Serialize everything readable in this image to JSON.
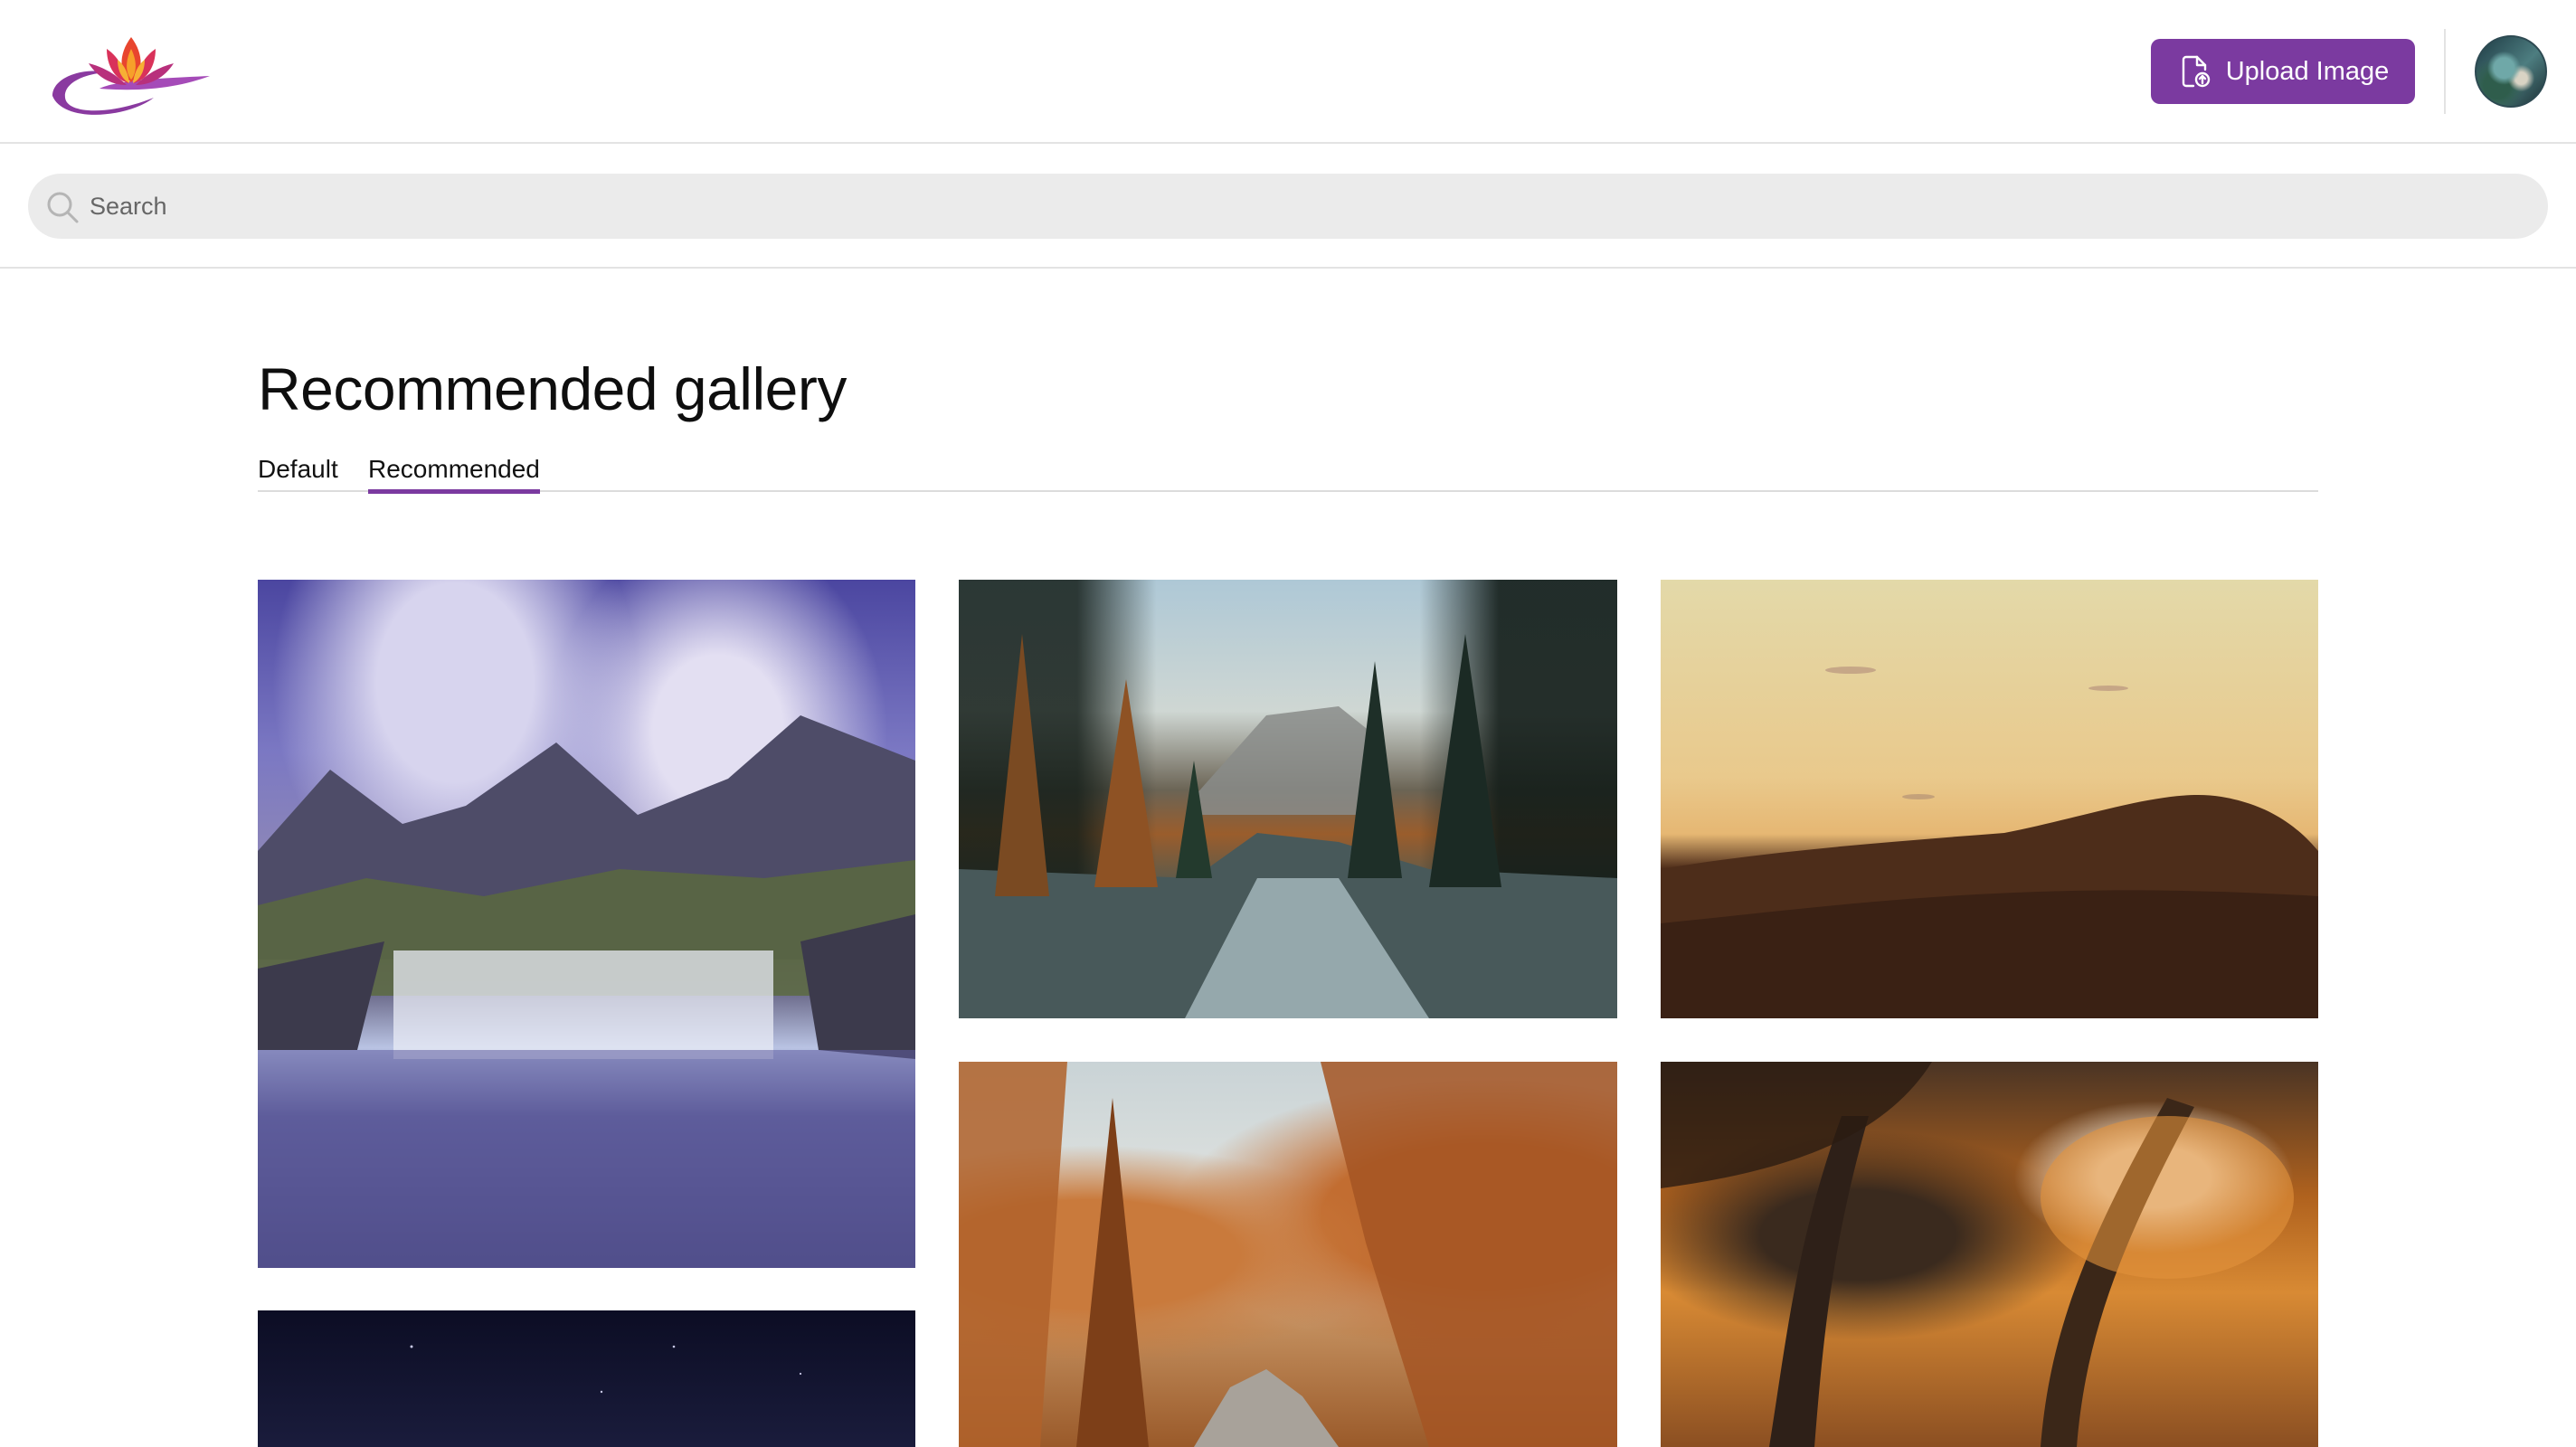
{
  "header": {
    "logo_name": "lotus-logo",
    "upload_label": "Upload Image",
    "upload_icon": "file-upload-icon",
    "accent_color": "#7b3aa0"
  },
  "search": {
    "placeholder": "Search",
    "value": "",
    "icon": "search-icon"
  },
  "main": {
    "title": "Recommended gallery",
    "tabs": [
      {
        "label": "Default",
        "active": false
      },
      {
        "label": "Recommended",
        "active": true
      }
    ]
  },
  "gallery": {
    "images": [
      {
        "name": "waterfall-mountain-photo"
      },
      {
        "name": "forest-river-photo"
      },
      {
        "name": "desert-dunes-photo"
      },
      {
        "name": "night-sky-photo"
      },
      {
        "name": "autumn-trees-valley-photo"
      },
      {
        "name": "autumn-forest-path-photo"
      }
    ]
  }
}
